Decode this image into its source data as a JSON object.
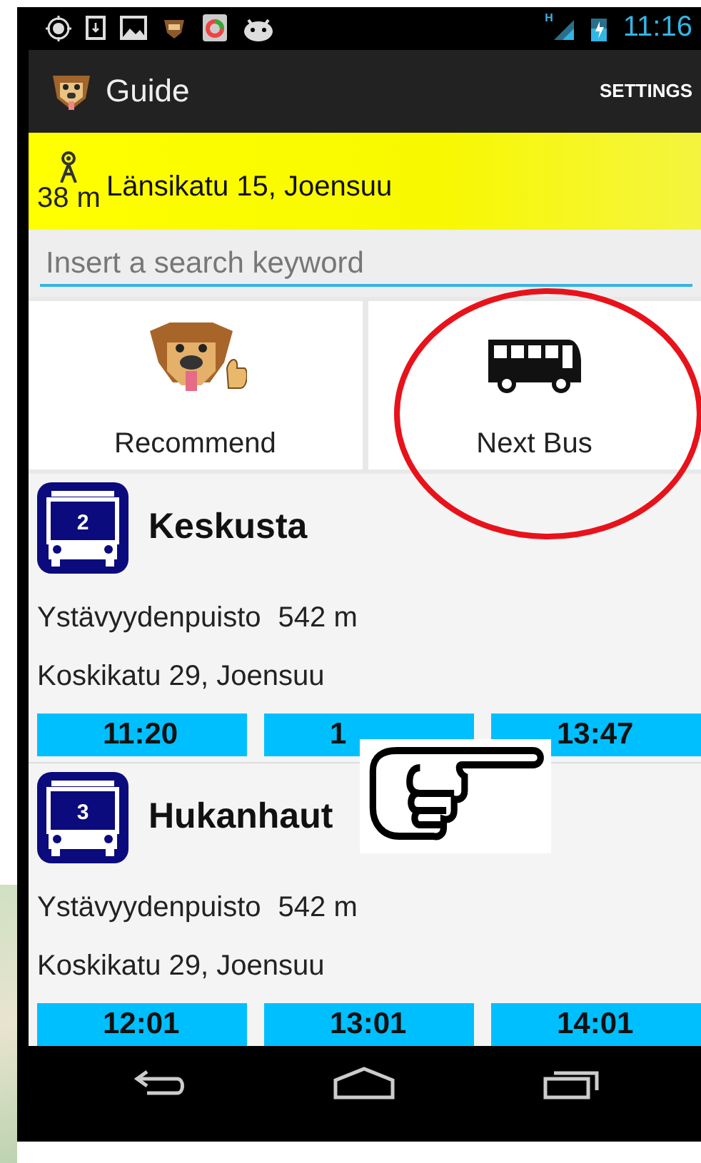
{
  "status_bar": {
    "network": "H",
    "time": "11:16"
  },
  "app_bar": {
    "title": "Guide",
    "action": "SETTINGS"
  },
  "location": {
    "distance": "38 m",
    "address": "Länsikatu 15, Joensuu"
  },
  "search": {
    "placeholder": "Insert a search keyword"
  },
  "tiles": [
    {
      "kind": "dog",
      "label": "Recommend"
    },
    {
      "kind": "bus",
      "label": "Next Bus"
    }
  ],
  "stops": [
    {
      "route": "2",
      "destination": "Keskusta",
      "stop_name": "Ystävyydenpuisto",
      "distance": "542 m",
      "address": "Koskikatu 29, Joensuu",
      "departures": [
        "11:20",
        "1",
        "13:47"
      ]
    },
    {
      "route": "3",
      "destination": "Hukanhaut",
      "stop_name": "Ystävyydenpuisto",
      "distance": "542 m",
      "address": "Koskikatu 29, Joensuu",
      "departures": [
        "12:01",
        "13:01",
        "14:01"
      ]
    }
  ],
  "annotations": {
    "highlight_circle": true,
    "pointing_hand": true
  }
}
